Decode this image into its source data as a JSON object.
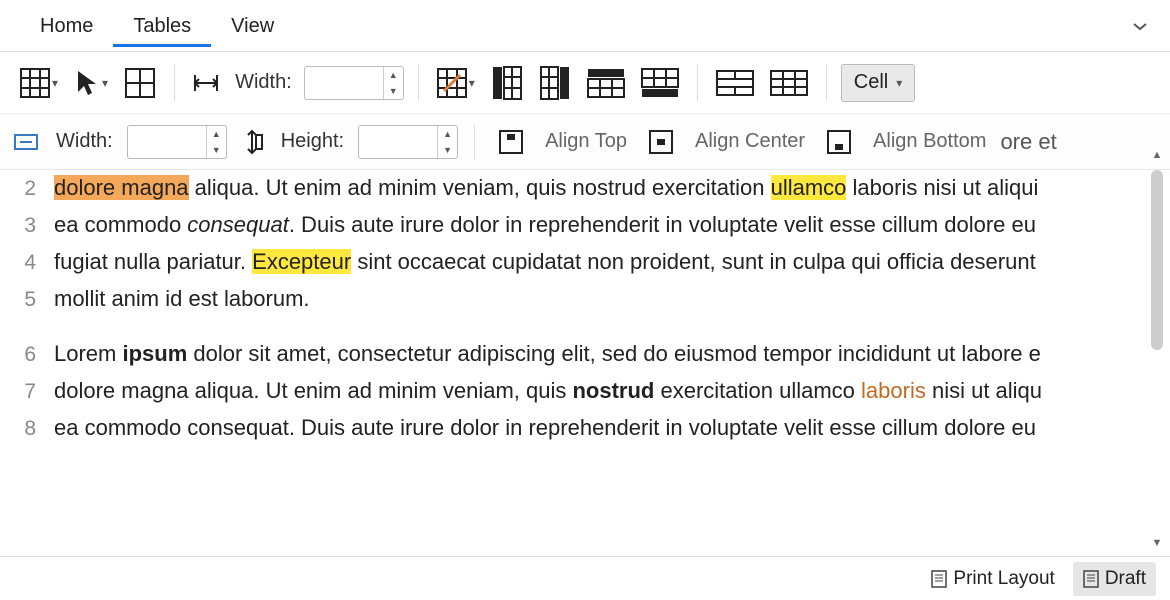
{
  "tabs": {
    "home": "Home",
    "tables": "Tables",
    "view": "View",
    "active": "Tables"
  },
  "toolbar1": {
    "width_label": "Width:",
    "width_value": "",
    "cell_button": "Cell"
  },
  "toolbar2": {
    "width_label": "Width:",
    "width_value": "",
    "height_label": "Height:",
    "height_value": "",
    "align_top": "Align Top",
    "align_center": "Align Center",
    "align_bottom": "Align Bottom",
    "trailing_text": "ore et"
  },
  "document": {
    "lines": [
      {
        "n": 2,
        "segments": [
          {
            "t": "dolore magna",
            "cls": "hl-orange"
          },
          {
            "t": " aliqua. Ut enim ad minim veniam, quis nostrud exercitation "
          },
          {
            "t": "ullamco",
            "cls": "hl-yellow"
          },
          {
            "t": " laboris nisi ut aliqui"
          }
        ]
      },
      {
        "n": 3,
        "segments": [
          {
            "t": "ea commodo "
          },
          {
            "t": "consequat",
            "cls": "italic"
          },
          {
            "t": ". Duis aute irure dolor in reprehenderit in voluptate velit esse cillum dolore eu"
          }
        ]
      },
      {
        "n": 4,
        "segments": [
          {
            "t": "fugiat nulla pariatur. "
          },
          {
            "t": "Excepteur",
            "cls": "hl-yellow"
          },
          {
            "t": " sint occaecat cupidatat non proident, sunt in culpa qui officia deserunt"
          }
        ]
      },
      {
        "n": 5,
        "segments": [
          {
            "t": "mollit anim id est laborum."
          }
        ]
      },
      {
        "gap": true
      },
      {
        "n": 6,
        "segments": [
          {
            "t": "Lorem "
          },
          {
            "t": "ipsum",
            "cls": "bold"
          },
          {
            "t": " dolor sit amet, consectetur adipiscing elit, sed do eiusmod tempor incididunt ut labore e"
          }
        ]
      },
      {
        "n": 7,
        "segments": [
          {
            "t": "dolore magna aliqua. Ut enim ad minim veniam, quis "
          },
          {
            "t": "nostrud",
            "cls": "bold"
          },
          {
            "t": " exercitation ullamco "
          },
          {
            "t": "laboris",
            "cls": "link"
          },
          {
            "t": " nisi ut aliqu"
          }
        ]
      },
      {
        "n": 8,
        "segments": [
          {
            "t": "ea commodo consequat. Duis aute irure dolor in reprehenderit in voluptate velit esse cillum dolore eu"
          }
        ]
      }
    ]
  },
  "status": {
    "print_layout": "Print Layout",
    "draft": "Draft"
  }
}
